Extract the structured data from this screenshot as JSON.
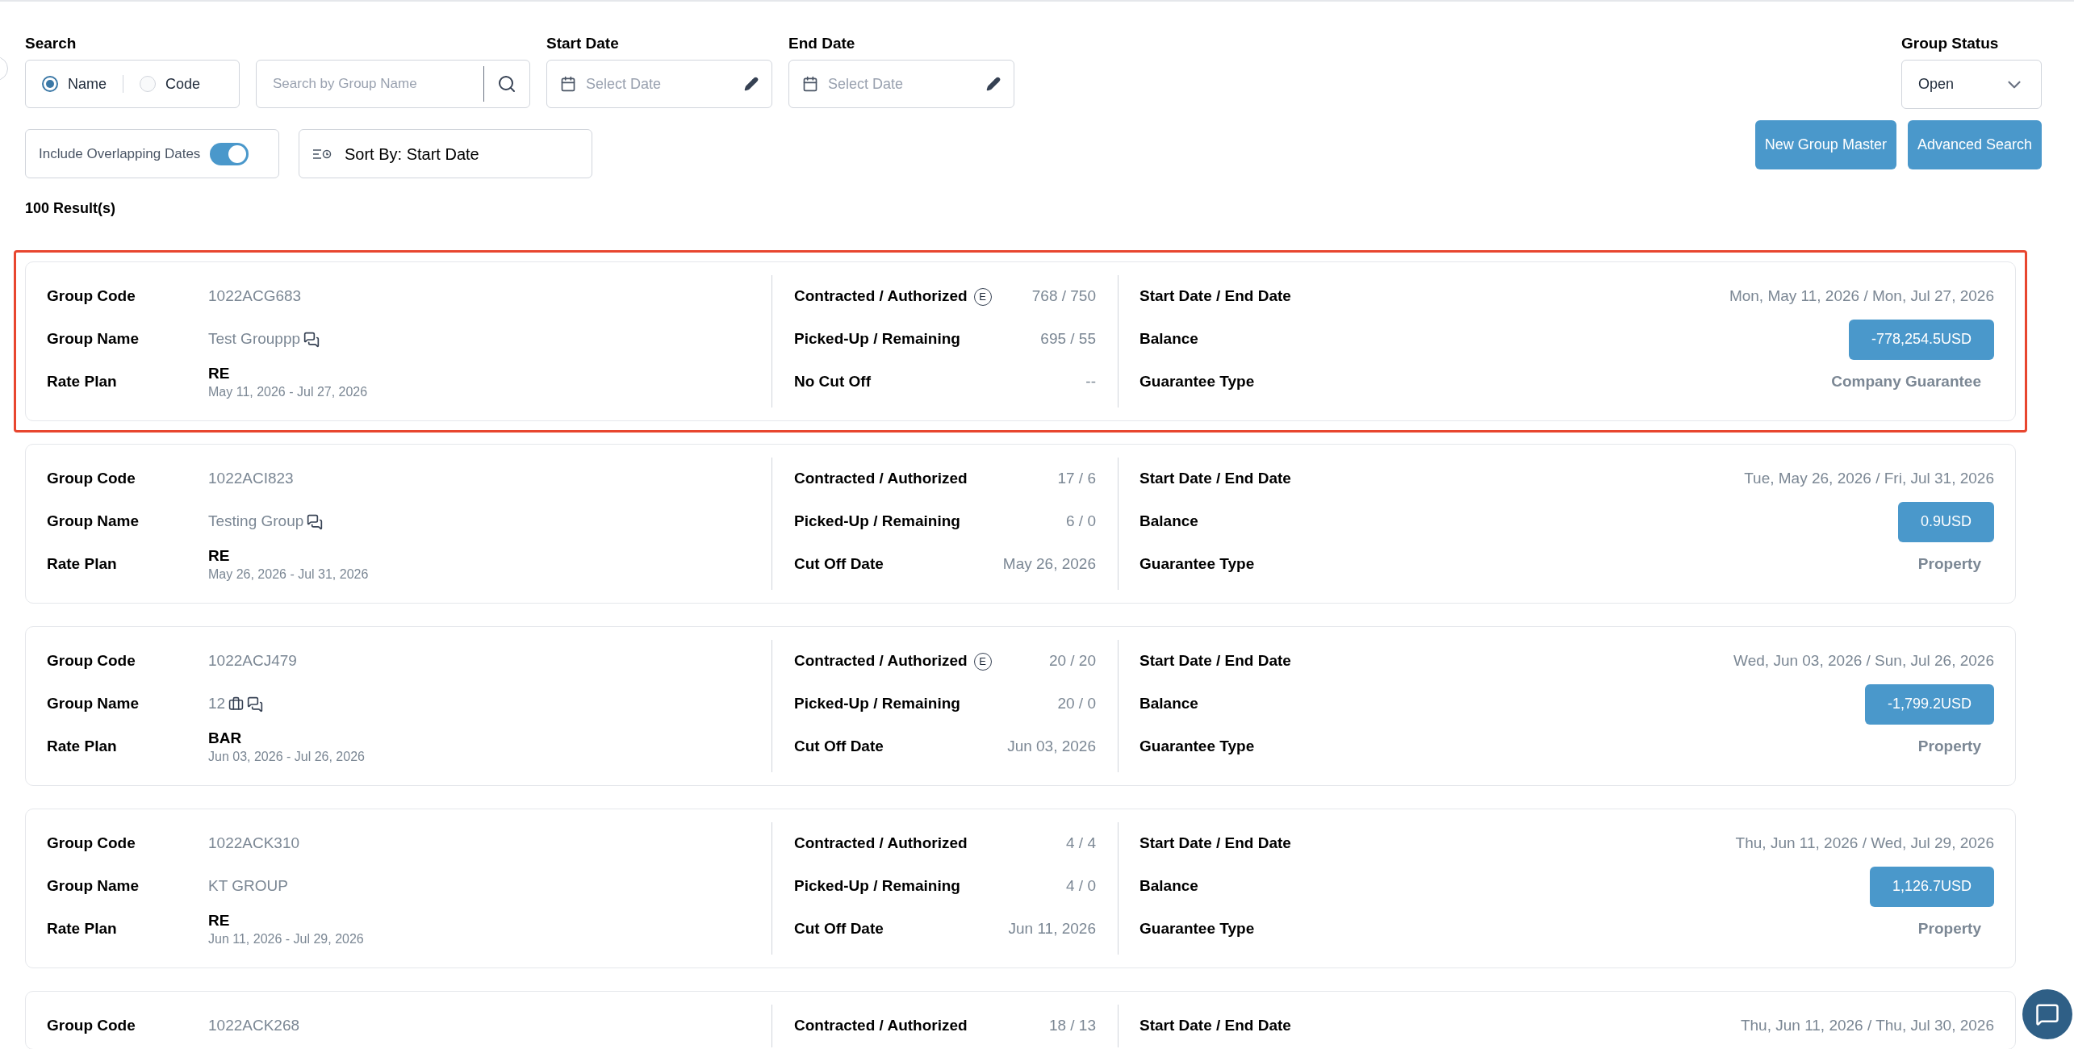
{
  "filters": {
    "search": {
      "label": "Search",
      "options": [
        {
          "label": "Name",
          "selected": true
        },
        {
          "label": "Code",
          "selected": false
        }
      ],
      "placeholder": "Search by Group Name"
    },
    "start_date": {
      "label": "Start Date",
      "placeholder": "Select Date"
    },
    "end_date": {
      "label": "End Date",
      "placeholder": "Select Date"
    },
    "group_status": {
      "label": "Group Status",
      "value": "Open"
    },
    "overlap": {
      "label": "Include Overlapping Dates",
      "on": true
    },
    "sort": {
      "label": "Sort By: Start Date"
    },
    "buttons": [
      "New Group Master",
      "Advanced Search"
    ]
  },
  "results_count": "100 Result(s)",
  "groups": [
    {
      "selected": true,
      "code_label": "Group Code",
      "code": "1022ACG683",
      "name_label": "Group Name",
      "name": "Test Grouppp",
      "comments_icon": true,
      "rate_label": "Rate Plan",
      "rate": "RE",
      "rate_dates": "May 11, 2026 - Jul 27, 2026",
      "contracted_label": "Contracted / Authorized",
      "contracted_badge": "E",
      "contracted": "768 / 750",
      "picked_label": "Picked-Up / Remaining",
      "picked": "695 / 55",
      "cutoff_label": "No Cut Off",
      "cutoff": "--",
      "dates_label": "Start Date / End Date",
      "dates": "Mon, May 11, 2026 / Mon, Jul 27, 2026",
      "balance_label": "Balance",
      "balance": "-778,254.5USD",
      "guarantee_label": "Guarantee Type",
      "guarantee": "Company Guarantee"
    },
    {
      "selected": false,
      "code_label": "Group Code",
      "code": "1022ACI823",
      "name_label": "Group Name",
      "name": "Testing Group",
      "comments_icon": true,
      "rate_label": "Rate Plan",
      "rate": "RE",
      "rate_dates": "May 26, 2026 - Jul 31, 2026",
      "contracted_label": "Contracted / Authorized",
      "contracted": "17 / 6",
      "picked_label": "Picked-Up / Remaining",
      "picked": "6 / 0",
      "cutoff_label": "Cut Off Date",
      "cutoff": "May 26, 2026",
      "dates_label": "Start Date / End Date",
      "dates": "Tue, May 26, 2026 / Fri, Jul 31, 2026",
      "balance_label": "Balance",
      "balance": "0.9USD",
      "guarantee_label": "Guarantee Type",
      "guarantee": "Property"
    },
    {
      "selected": false,
      "code_label": "Group Code",
      "code": "1022ACJ479",
      "name_label": "Group Name",
      "name": "12",
      "payment_icon": true,
      "comments_icon": true,
      "rate_label": "Rate Plan",
      "rate": "BAR",
      "rate_dates": "Jun 03, 2026 - Jul 26, 2026",
      "contracted_label": "Contracted / Authorized",
      "contracted_badge": "E",
      "contracted": "20 / 20",
      "picked_label": "Picked-Up / Remaining",
      "picked": "20 / 0",
      "cutoff_label": "Cut Off Date",
      "cutoff": "Jun 03, 2026",
      "dates_label": "Start Date / End Date",
      "dates": "Wed, Jun 03, 2026 / Sun, Jul 26, 2026",
      "balance_label": "Balance",
      "balance": "-1,799.2USD",
      "guarantee_label": "Guarantee Type",
      "guarantee": "Property"
    },
    {
      "selected": false,
      "code_label": "Group Code",
      "code": "1022ACK310",
      "name_label": "Group Name",
      "name": "KT GROUP",
      "rate_label": "Rate Plan",
      "rate": "RE",
      "rate_dates": "Jun 11, 2026 - Jul 29, 2026",
      "contracted_label": "Contracted / Authorized",
      "contracted": "4 / 4",
      "picked_label": "Picked-Up / Remaining",
      "picked": "4 / 0",
      "cutoff_label": "Cut Off Date",
      "cutoff": "Jun 11, 2026",
      "dates_label": "Start Date / End Date",
      "dates": "Thu, Jun 11, 2026 / Wed, Jul 29, 2026",
      "balance_label": "Balance",
      "balance": "1,126.7USD",
      "guarantee_label": "Guarantee Type",
      "guarantee": "Property"
    },
    {
      "selected": false,
      "code_label": "Group Code",
      "code": "1022ACK268",
      "contracted_label": "Contracted / Authorized",
      "contracted": "18 / 13",
      "dates_label": "Start Date / End Date",
      "dates": "Thu, Jun 11, 2026 / Thu, Jul 30, 2026"
    }
  ]
}
